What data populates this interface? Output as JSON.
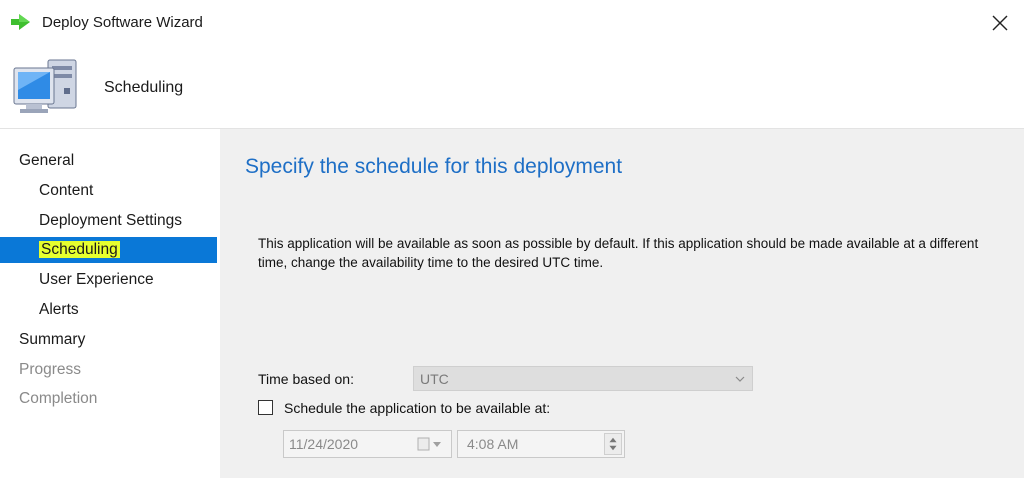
{
  "window": {
    "title": "Deploy Software Wizard",
    "icons": {
      "title": "green-arrow-icon",
      "close": "close-icon"
    }
  },
  "header": {
    "title": "Scheduling",
    "icon": "computer-icon"
  },
  "nav": {
    "items": [
      {
        "label": "General",
        "level": "top",
        "state": "normal"
      },
      {
        "label": "Content",
        "level": "sub",
        "state": "normal"
      },
      {
        "label": "Deployment Settings",
        "level": "sub",
        "state": "normal"
      },
      {
        "label": "Scheduling",
        "level": "sub",
        "state": "selected"
      },
      {
        "label": "User Experience",
        "level": "sub",
        "state": "normal"
      },
      {
        "label": "Alerts",
        "level": "sub",
        "state": "normal"
      },
      {
        "label": "Summary",
        "level": "top",
        "state": "normal"
      },
      {
        "label": "Progress",
        "level": "top",
        "state": "disabled"
      },
      {
        "label": "Completion",
        "level": "top",
        "state": "disabled"
      }
    ]
  },
  "main": {
    "heading": "Specify the schedule for this deployment",
    "description": "This application will be available as soon as possible by default. If this application should be made available at a different time, change the availability time to the desired UTC time.",
    "time_based_on": {
      "label": "Time based on:",
      "value": "UTC"
    },
    "schedule": {
      "label": "Schedule the application to be available at:",
      "checked": false,
      "date": "11/24/2020",
      "time": "4:08 AM"
    }
  },
  "colors": {
    "accent": "#0a78d7",
    "highlight": "#e6ff2e",
    "heading": "#1e6fc6",
    "panel_bg": "#f0f0f0"
  }
}
